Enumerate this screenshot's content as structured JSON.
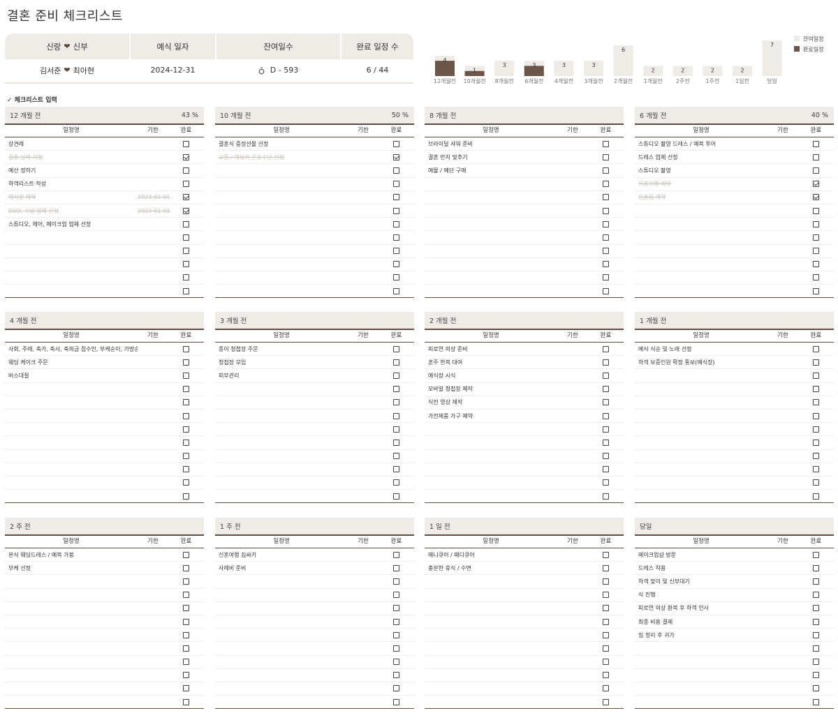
{
  "title": "결혼 준비 체크리스트",
  "summary": {
    "headers": [
      "신랑",
      "신부",
      "예식 일자",
      "잔여일수",
      "완료 일정 수"
    ],
    "groom": "김서준",
    "bride": "최아현",
    "wedding_date": "2024-12-31",
    "dday": "D - 593",
    "completed": "6 / 44"
  },
  "chart_data": {
    "type": "bar",
    "stacked": true,
    "categories": [
      "12개월전",
      "10개월전",
      "8개월전",
      "6개월전",
      "4개월전",
      "3개월전",
      "2개월전",
      "1개월전",
      "2주전",
      "1주전",
      "1일전",
      "당일"
    ],
    "series": [
      {
        "name": "잔여일정",
        "values": [
          4,
          2,
          3,
          3,
          3,
          3,
          6,
          2,
          2,
          2,
          2,
          7
        ],
        "color": "#efebe6"
      },
      {
        "name": "완료일정",
        "values": [
          3,
          1,
          0,
          2,
          0,
          0,
          0,
          0,
          0,
          0,
          0,
          0
        ],
        "color": "#6b5548"
      }
    ],
    "data_labels": [
      "4",
      "1",
      "3",
      "3",
      "3",
      "3",
      "6",
      "2",
      "2",
      "2",
      "2",
      "7"
    ],
    "legend": "top-right",
    "grid": false
  },
  "section_label": "✓ 체크리스트 입력",
  "columns": {
    "name": "일정명",
    "due": "기한",
    "done": "완료"
  },
  "panels": [
    {
      "title": "12 개월 전",
      "pct": "43 %",
      "rows": 12,
      "items": [
        {
          "name": "상견례",
          "due": "",
          "done": false
        },
        {
          "name": "결혼 날짜 지정",
          "due": "",
          "done": true
        },
        {
          "name": "예산 정하기",
          "due": "",
          "done": false
        },
        {
          "name": "하객리스트 작성",
          "due": "",
          "done": false
        },
        {
          "name": "예식장 예약",
          "due": "2023-01-01",
          "done": true
        },
        {
          "name": "DVD, 스냅 업체 선정",
          "due": "2023-01-01",
          "done": true
        },
        {
          "name": "스튜디오, 헤어, 메이크업 업체 선정",
          "due": "",
          "done": false
        }
      ]
    },
    {
      "title": "10 개월 전",
      "pct": "50 %",
      "rows": 12,
      "items": [
        {
          "name": "결혼식 증정선물 선정",
          "due": "",
          "done": false
        },
        {
          "name": "교통 / 웨딩카 운송수단 선정",
          "due": "",
          "done": true
        }
      ]
    },
    {
      "title": "8 개월 전",
      "pct": "",
      "rows": 12,
      "items": [
        {
          "name": "브라이덜 샤워 준비",
          "due": "",
          "done": false
        },
        {
          "name": "결혼 반지 맞추기",
          "due": "",
          "done": false
        },
        {
          "name": "예물 / 예단 구매",
          "due": "",
          "done": false
        }
      ]
    },
    {
      "title": "6 개월 전",
      "pct": "40 %",
      "rows": 12,
      "items": [
        {
          "name": "스튜디오 촬영 드레스 / 예복 투어",
          "due": "",
          "done": false
        },
        {
          "name": "드레스 업체 선정",
          "due": "",
          "done": false
        },
        {
          "name": "스튜디오 촬영",
          "due": "",
          "done": false
        },
        {
          "name": "신혼여행 예약",
          "due": "",
          "done": true
        },
        {
          "name": "신혼집 계약",
          "due": "",
          "done": true
        }
      ]
    },
    {
      "title": "4 개월 전",
      "pct": "",
      "rows": 12,
      "items": [
        {
          "name": "사회, 주례, 축가, 축사, 축의금 접수인, 부케순이, 가방순이 섭외",
          "due": "",
          "done": false
        },
        {
          "name": "웨딩 케이크 주문",
          "due": "",
          "done": false
        },
        {
          "name": "버스대절",
          "due": "",
          "done": false
        }
      ]
    },
    {
      "title": "3 개월 전",
      "pct": "",
      "rows": 12,
      "items": [
        {
          "name": "종이 청첩장 주문",
          "due": "",
          "done": false
        },
        {
          "name": "청첩장 모임",
          "due": "",
          "done": false
        },
        {
          "name": "피부관리",
          "due": "",
          "done": false
        }
      ]
    },
    {
      "title": "2 개월 전",
      "pct": "",
      "rows": 12,
      "items": [
        {
          "name": "피로연 의상 준비",
          "due": "",
          "done": false
        },
        {
          "name": "혼주 한복 대여",
          "due": "",
          "done": false
        },
        {
          "name": "예식장 시식",
          "due": "",
          "done": false
        },
        {
          "name": "모바일 청첩장 제작",
          "due": "",
          "done": false
        },
        {
          "name": "식전 영상 제작",
          "due": "",
          "done": false
        },
        {
          "name": "가전제품 가구 예약",
          "due": "",
          "done": false
        }
      ]
    },
    {
      "title": "1 개월 전",
      "pct": "",
      "rows": 12,
      "items": [
        {
          "name": "예식 식순 및 노래 선정",
          "due": "",
          "done": false
        },
        {
          "name": "하객 보증인원 확정 통보(예식장)",
          "due": "",
          "done": false
        }
      ]
    },
    {
      "title": "2 주 전",
      "pct": "",
      "rows": 12,
      "items": [
        {
          "name": "본식 웨딩드레스 / 예복 가봉",
          "due": "",
          "done": false
        },
        {
          "name": "부케 선정",
          "due": "",
          "done": false
        }
      ]
    },
    {
      "title": "1 주 전",
      "pct": "",
      "rows": 12,
      "items": [
        {
          "name": "신혼여행 짐싸기",
          "due": "",
          "done": false
        },
        {
          "name": "사례비 준비",
          "due": "",
          "done": false
        }
      ]
    },
    {
      "title": "1 일 전",
      "pct": "",
      "rows": 12,
      "items": [
        {
          "name": "매니큐어 / 패디큐어",
          "due": "",
          "done": false
        },
        {
          "name": "충분한 휴식 / 수면",
          "due": "",
          "done": false
        }
      ]
    },
    {
      "title": "당일",
      "pct": "",
      "rows": 12,
      "items": [
        {
          "name": "메이크업샵 방문",
          "due": "",
          "done": false
        },
        {
          "name": "드레스 착용",
          "due": "",
          "done": false
        },
        {
          "name": "하객 맞이 및 신부대기",
          "due": "",
          "done": false
        },
        {
          "name": "식 진행",
          "due": "",
          "done": false
        },
        {
          "name": "피로연 의상 환복 후 하객 인사",
          "due": "",
          "done": false
        },
        {
          "name": "최종 비용 결제",
          "due": "",
          "done": false
        },
        {
          "name": "짐 정리 후 귀가",
          "due": "",
          "done": false
        }
      ]
    }
  ]
}
